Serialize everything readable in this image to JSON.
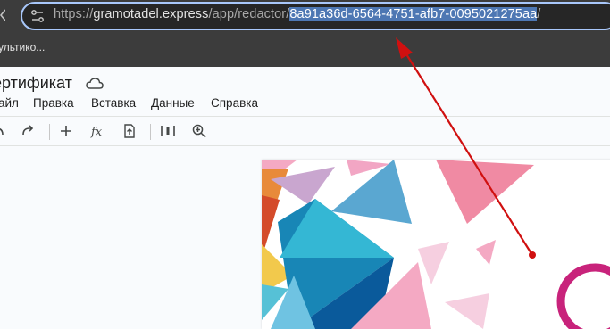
{
  "browser": {
    "url_prefix": "https://",
    "url_host": "gramotadel.express",
    "url_path": "/app/redactor/",
    "url_selected": "8a91a36d-6564-4751-afb7-0095021275aa",
    "url_suffix": "/",
    "bookmark_label": "ультико..."
  },
  "document": {
    "title": "ертификат"
  },
  "menu": {
    "items": [
      "айл",
      "Правка",
      "Вставка",
      "Данные",
      "Справка"
    ]
  },
  "toolbar": {
    "icons": [
      "undo-icon",
      "redo-icon",
      "add-icon",
      "function-icon",
      "upload-icon",
      "align-icon",
      "zoom-icon"
    ]
  },
  "colors": {
    "annotation_arrow": "#d01010",
    "selection": "#4d77b3",
    "address_border": "#a8c7fa"
  }
}
